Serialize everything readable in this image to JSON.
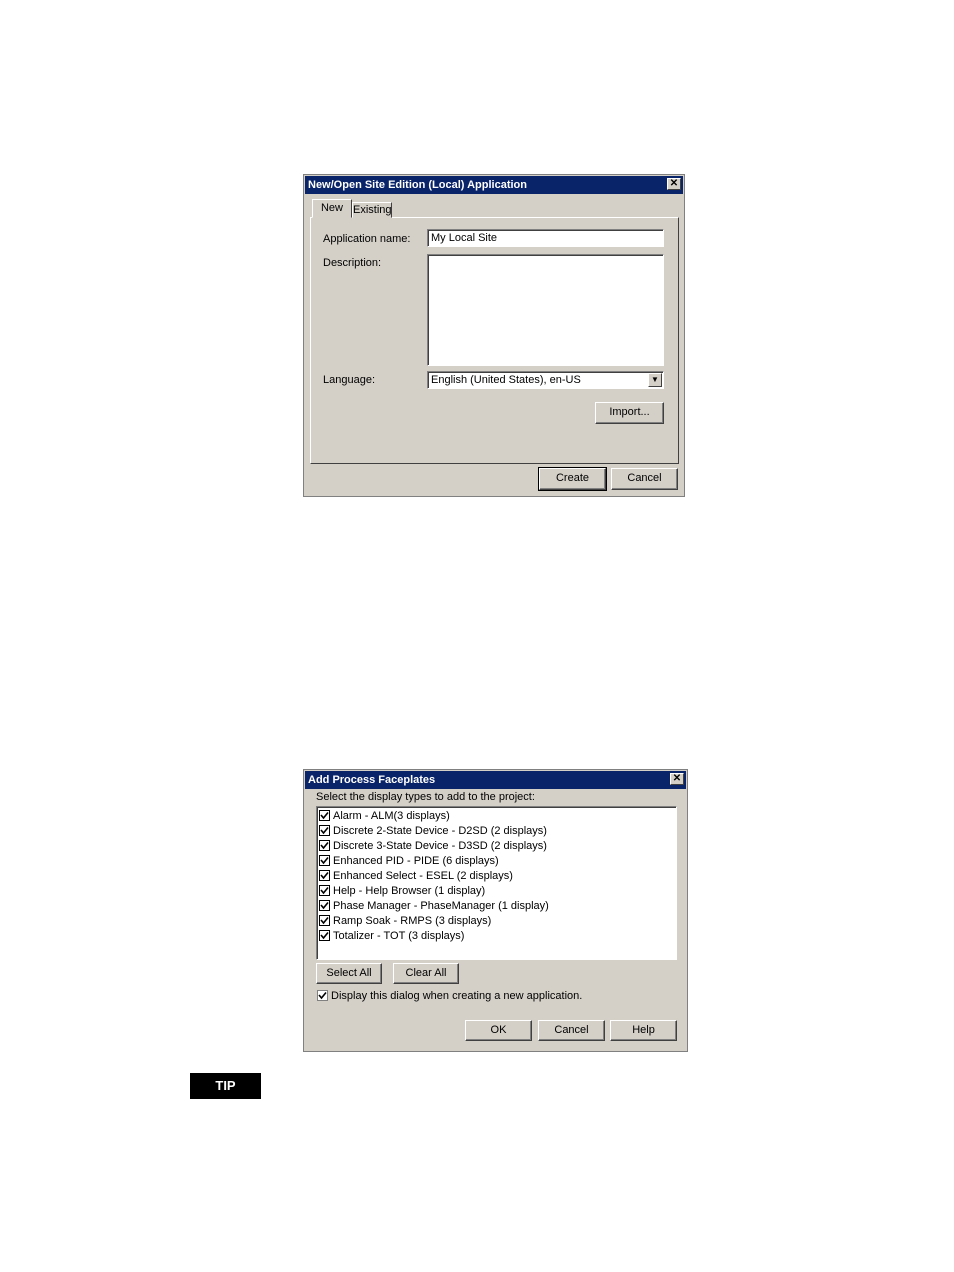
{
  "dialog1": {
    "title": "New/Open Site Edition (Local) Application",
    "tabs": [
      "New",
      "Existing"
    ],
    "application_name_label": "Application name:",
    "application_name_value": "My Local Site",
    "description_label": "Description:",
    "description_value": "",
    "language_label": "Language:",
    "language_value": "English (United States), en-US",
    "import_button": "Import...",
    "create_button": "Create",
    "cancel_button": "Cancel"
  },
  "dialog2": {
    "title": "Add Process Faceplates",
    "instruction": "Select the display types to add to the project:",
    "items": [
      {
        "label": "Alarm - ALM(3 displays)",
        "checked": true
      },
      {
        "label": "Discrete 2-State Device - D2SD (2 displays)",
        "checked": true
      },
      {
        "label": "Discrete 3-State Device - D3SD (2 displays)",
        "checked": true
      },
      {
        "label": "Enhanced PID - PIDE (6 displays)",
        "checked": true
      },
      {
        "label": "Enhanced Select - ESEL (2 displays)",
        "checked": true
      },
      {
        "label": "Help - Help Browser (1 display)",
        "checked": true
      },
      {
        "label": "Phase Manager - PhaseManager (1 display)",
        "checked": true
      },
      {
        "label": "Ramp Soak - RMPS (3 displays)",
        "checked": true
      },
      {
        "label": "Totalizer - TOT (3 displays)",
        "checked": true
      }
    ],
    "select_all_button": "Select All",
    "clear_all_button": "Clear All",
    "show_dialog_label": "Display this dialog when creating a new application.",
    "show_dialog_checked": true,
    "ok_button": "OK",
    "cancel_button": "Cancel",
    "help_button": "Help"
  },
  "tip_label": "TIP"
}
